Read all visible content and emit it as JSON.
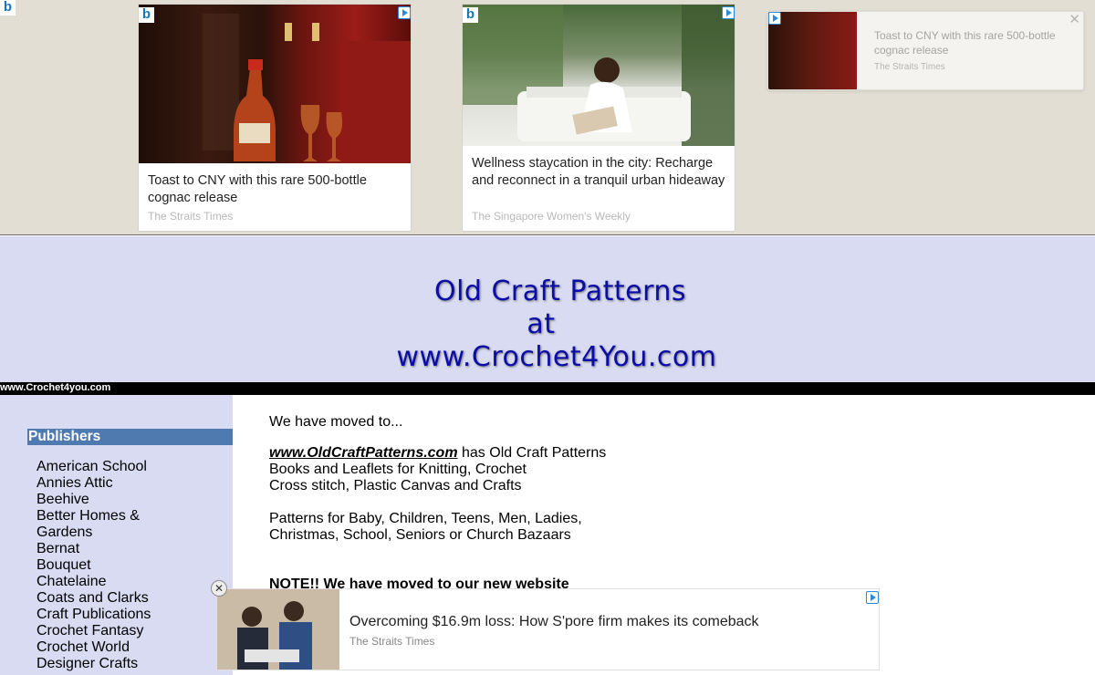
{
  "ads": {
    "corner_logo": "b",
    "card1": {
      "logo": "b",
      "title": "Toast to CNY with this rare 500-bottle cognac release",
      "source": "The Straits Times"
    },
    "card2": {
      "logo": "b",
      "title": "Wellness staycation in the city: Recharge and reconnect in a tranquil urban hideaway",
      "source": "The Singapore Women's Weekly"
    },
    "card3": {
      "title": "Toast to CNY with this rare 500-bottle cognac release",
      "source": "The Straits Times",
      "close": "✕"
    }
  },
  "banner": {
    "line1": "Old Craft Patterns",
    "line2": "at",
    "line3": "www.Crochet4You.com",
    "color": "#0c0ca8"
  },
  "site_bar": "www.Crochet4you.com",
  "sidebar": {
    "header": "Publishers",
    "items": [
      "American School",
      "Annies Attic",
      "Beehive",
      "Better Homes & Gardens",
      "Bernat",
      "Bouquet",
      "Chatelaine",
      "Coats and Clarks",
      "Craft Publications",
      "Crochet Fantasy",
      "Crochet World",
      "Designer Crafts"
    ]
  },
  "main": {
    "moved": "We have moved to...",
    "link": "www.OldCraftPatterns.com",
    "p1_rest": " has Old Craft Patterns",
    "p1_line2": "Books and Leaflets for Knitting, Crochet",
    "p1_line3": "Cross stitch, Plastic Canvas and Crafts",
    "p2_line1": "Patterns for Baby, Children, Teens, Men, Ladies,",
    "p2_line2": "Christmas, School, Seniors or Church Bazaars",
    "note": "NOTE!! We have moved to our new website"
  },
  "bottom_ad": {
    "headline": "Overcoming $16.9m loss: How S'pore firm makes its comeback",
    "source": "The Straits Times",
    "close": "✕"
  }
}
